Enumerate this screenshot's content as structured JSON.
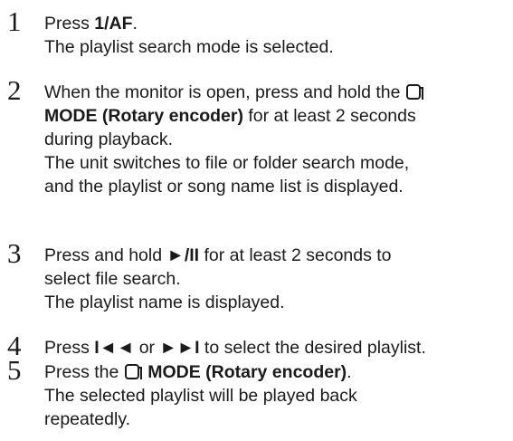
{
  "steps": [
    {
      "number": "1",
      "press": "Press ",
      "button": "1/AF",
      "period": ".",
      "result": "The playlist search mode is selected."
    },
    {
      "number": "2",
      "line1": "When the monitor is open, press and hold the ",
      "button_icon": "mode-icon",
      "button": "MODE (Rotary encoder)",
      "line2_rest": " for at least 2 seconds",
      "line3": "during playback.",
      "result_line1": "The unit switches to file or folder search mode,",
      "result_line2": "and the playlist or song name list is displayed."
    },
    {
      "number": "3",
      "press": "Press and hold ",
      "button": "►/II",
      "line1_rest": " for at least 2 seconds to",
      "line2": "select file search.",
      "result": "The playlist name is displayed."
    },
    {
      "number": "4",
      "press": "Press ",
      "button_prev": "I◄◄",
      "or": " or ",
      "button_next": "►►I",
      "rest": " to select the desired playlist."
    },
    {
      "number": "5",
      "press": "Press the ",
      "button_icon": "mode-icon",
      "button": " MODE (Rotary encoder)",
      "period": ".",
      "result_line1": "The selected playlist will be played back",
      "result_line2": "repeatedly."
    }
  ]
}
